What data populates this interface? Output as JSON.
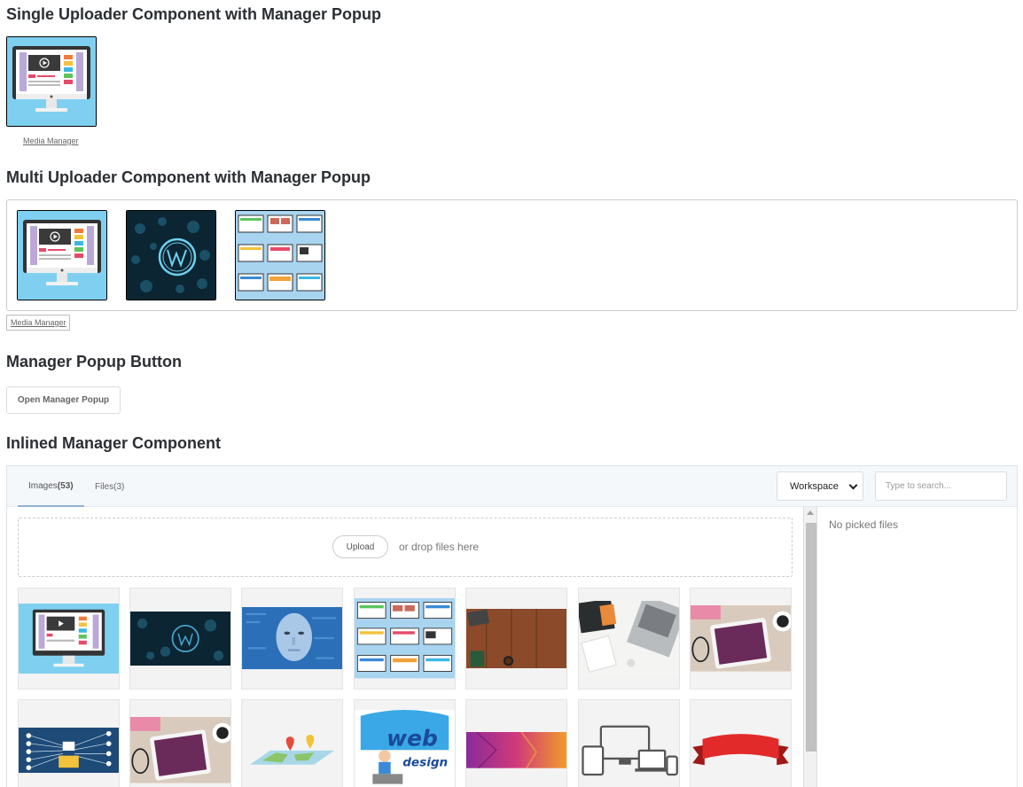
{
  "sections": {
    "single_title": "Single Uploader Component with Manager Popup",
    "multi_title": "Multi Uploader Component with Manager Popup",
    "popup_title": "Manager Popup Button",
    "inline_title": "Inlined Manager Component"
  },
  "single": {
    "link_label": "Media Manager",
    "image": "monitor-dashboard"
  },
  "multi": {
    "link_label": "Media Manager",
    "images": [
      "monitor-dashboard",
      "wordpress-blue",
      "website-grid"
    ]
  },
  "popup": {
    "button_label": "Open Manager Popup"
  },
  "manager": {
    "tabs": [
      {
        "label": "Images",
        "count": "(53)",
        "active": true
      },
      {
        "label": "Files",
        "count": "(3)",
        "active": false
      }
    ],
    "workspace_select": {
      "selected": "Workspace"
    },
    "search_placeholder": "Type to search...",
    "upload_label": "Upload",
    "drop_text": "or drop files here",
    "picked_text": "No picked files",
    "tiles": [
      "monitor-dashboard",
      "wordpress-blue",
      "digital-face",
      "website-grid",
      "wood-desk",
      "laptop-desk",
      "tablet-desk",
      "network-diagram",
      "tablet-desk-2",
      "world-map",
      "web-design",
      "orange-purple-abstract",
      "devices-outline",
      "red-ribbon"
    ]
  },
  "colors": {
    "accent": "#8fb3d6",
    "heading": "#2b2f33"
  }
}
